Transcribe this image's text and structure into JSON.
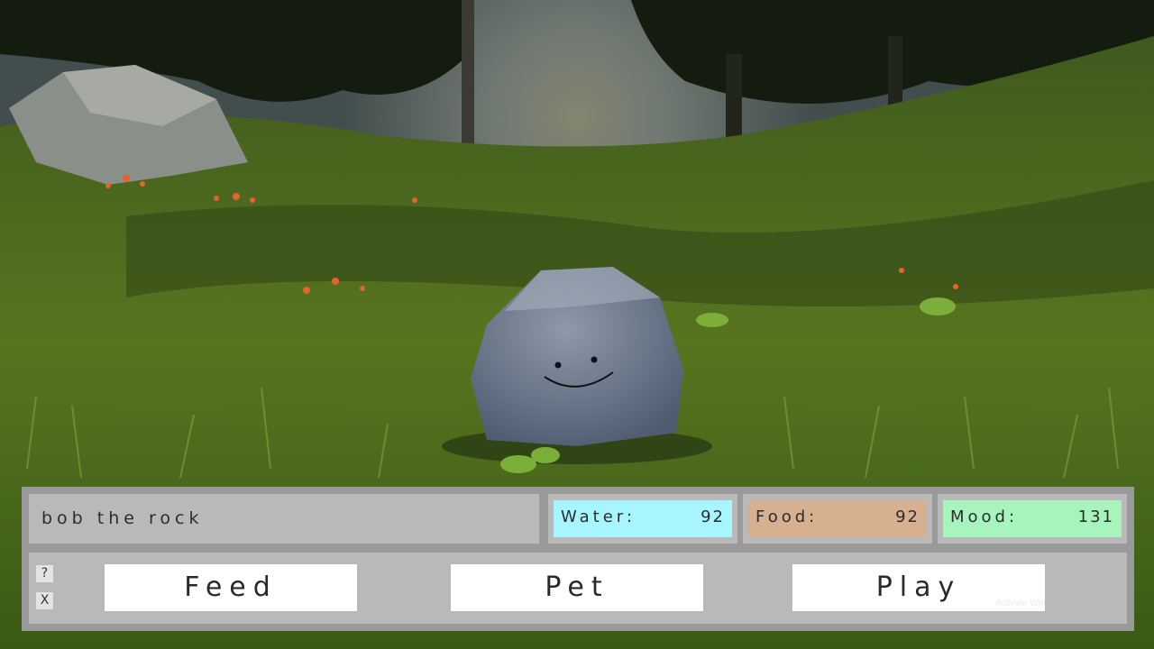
{
  "pet": {
    "name": "bob the rock"
  },
  "stats": {
    "water": {
      "label": "Water:",
      "value": "92",
      "color": "#a7f5ff"
    },
    "food": {
      "label": "Food:",
      "value": "92",
      "color": "#d6b08f"
    },
    "mood": {
      "label": "Mood:",
      "value": "131",
      "color": "#a7f4bd"
    }
  },
  "controls": {
    "help_label": "?",
    "close_label": "X",
    "feed_label": "Feed",
    "pet_label": "Pet",
    "play_label": "Play"
  },
  "watermark": {
    "text": "Activate Win"
  }
}
